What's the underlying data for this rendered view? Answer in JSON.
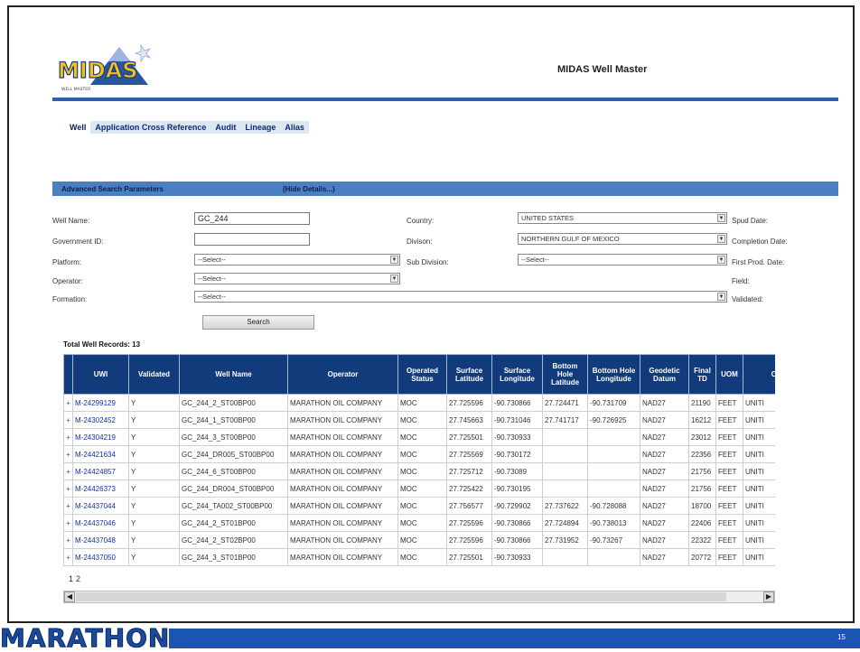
{
  "header": {
    "logo_text": "MIDAS",
    "logo_sub": "WELL MASTER",
    "app_title": "MIDAS Well Master"
  },
  "tabs": [
    {
      "label": "Well"
    },
    {
      "label": "Application Cross Reference"
    },
    {
      "label": "Audit"
    },
    {
      "label": "Lineage"
    },
    {
      "label": "Alias"
    }
  ],
  "search": {
    "title": "Advanced Search Parameters",
    "hide_label": "(Hide Details...)",
    "well_name_label": "Well Name:",
    "well_name_value": "GC_244",
    "government_id_label": "Government ID:",
    "government_id_value": "",
    "platform_label": "Platform:",
    "platform_value": "--Select--",
    "operator_label": "Operator:",
    "operator_value": "--Select--",
    "formation_label": "Formation:",
    "formation_value": "--Select--",
    "country_label": "Country:",
    "country_value": "UNITED STATES",
    "division_label": "Divison:",
    "division_value": "NORTHERN GULF OF MEXICO",
    "sub_division_label": "Sub Division:",
    "sub_division_value": "--Select--",
    "spud_date_label": "Spud Date:",
    "completion_date_label": "Completion Date:",
    "first_prod_date_label": "First Prod. Date:",
    "field_label": "Field:",
    "validated_label": "Validated:",
    "search_button": "Search"
  },
  "results": {
    "total_label": "Total Well Records: 13",
    "columns": [
      "",
      "UWI",
      "Validated",
      "Well Name",
      "Operator",
      "Operated Status",
      "Surface Latitude",
      "Surface Longitude",
      "Bottom Hole Latitude",
      "Bottom Hole Longitude",
      "Geodetic Datum",
      "Final TD",
      "UOM",
      "C"
    ],
    "rows": [
      [
        "+",
        "M-24299129",
        "Y",
        "GC_244_2_ST00BP00",
        "MARATHON OIL COMPANY",
        "MOC",
        "27.725596",
        "-90.730866",
        "27.724471",
        "-90.731709",
        "NAD27",
        "21190",
        "FEET",
        "UNITI"
      ],
      [
        "+",
        "M-24302452",
        "Y",
        "GC_244_1_ST00BP00",
        "MARATHON OIL COMPANY",
        "MOC",
        "27.745663",
        "-90.731046",
        "27.741717",
        "-90.726925",
        "NAD27",
        "16212",
        "FEET",
        "UNITI"
      ],
      [
        "+",
        "M-24304219",
        "Y",
        "GC_244_3_ST00BP00",
        "MARATHON OIL COMPANY",
        "MOC",
        "27.725501",
        "-90.730933",
        "",
        "",
        "NAD27",
        "23012",
        "FEET",
        "UNITI"
      ],
      [
        "+",
        "M-24421634",
        "Y",
        "GC_244_DR005_ST00BP00",
        "MARATHON OIL COMPANY",
        "MOC",
        "27.725569",
        "-90.730172",
        "",
        "",
        "NAD27",
        "22356",
        "FEET",
        "UNITI"
      ],
      [
        "+",
        "M-24424857",
        "Y",
        "GC_244_6_ST00BP00",
        "MARATHON OIL COMPANY",
        "MOC",
        "27.725712",
        "-90.73089",
        "",
        "",
        "NAD27",
        "21756",
        "FEET",
        "UNITI"
      ],
      [
        "+",
        "M-24426373",
        "Y",
        "GC_244_DR004_ST00BP00",
        "MARATHON OIL COMPANY",
        "MOC",
        "27.725422",
        "-90.730195",
        "",
        "",
        "NAD27",
        "21756",
        "FEET",
        "UNITI"
      ],
      [
        "+",
        "M-24437044",
        "Y",
        "GC_244_TA002_ST00BP00",
        "MARATHON OIL COMPANY",
        "MOC",
        "27.756577",
        "-90.729902",
        "27.737622",
        "-90.728088",
        "NAD27",
        "18700",
        "FEET",
        "UNITI"
      ],
      [
        "+",
        "M-24437046",
        "Y",
        "GC_244_2_ST01BP00",
        "MARATHON OIL COMPANY",
        "MOC",
        "27.725596",
        "-90.730866",
        "27.724894",
        "-90.738013",
        "NAD27",
        "22406",
        "FEET",
        "UNITI"
      ],
      [
        "+",
        "M-24437048",
        "Y",
        "GC_244_2_ST02BP00",
        "MARATHON OIL COMPANY",
        "MOC",
        "27.725596",
        "-90.730866",
        "27.731952",
        "-90.73267",
        "NAD27",
        "22322",
        "FEET",
        "UNITI"
      ],
      [
        "+",
        "M-24437050",
        "Y",
        "GC_244_3_ST01BP00",
        "MARATHON OIL COMPANY",
        "MOC",
        "27.725501",
        "-90.730933",
        "",
        "",
        "NAD27",
        "20772",
        "FEET",
        "UNITI"
      ]
    ],
    "pager": {
      "page1": "1",
      "page2": "2"
    }
  },
  "footer": {
    "brand": "MARATHON",
    "page_number": "15"
  },
  "colors": {
    "accent": "#2f5fae",
    "header_cell": "#123b7c",
    "link": "#1a2fa5",
    "footer_bar": "#1b54b3"
  }
}
